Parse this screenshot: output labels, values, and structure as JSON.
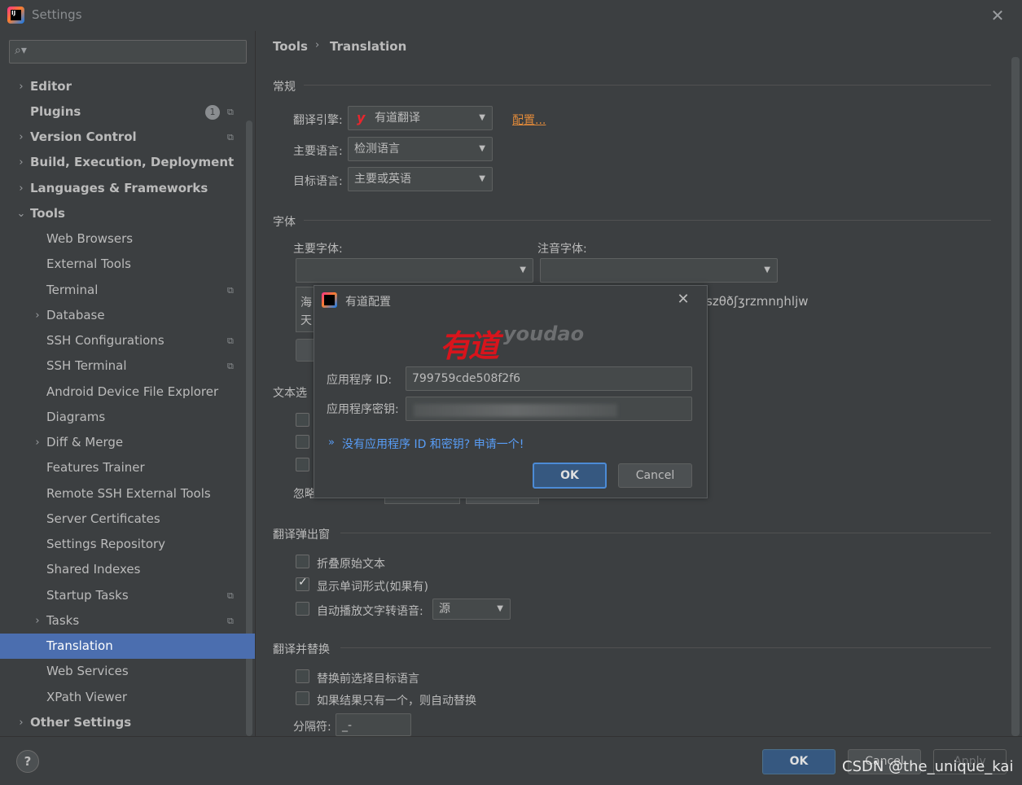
{
  "window": {
    "title": "Settings"
  },
  "sidebar": {
    "items": [
      {
        "label": "Editor",
        "arrow": "›"
      },
      {
        "label": "Plugins",
        "badge": "1"
      },
      {
        "label": "Version Control",
        "arrow": "›"
      },
      {
        "label": "Build, Execution, Deployment",
        "arrow": "›"
      },
      {
        "label": "Languages & Frameworks",
        "arrow": "›"
      },
      {
        "label": "Tools",
        "arrow": "⌄"
      },
      {
        "label": "Web Browsers"
      },
      {
        "label": "External Tools"
      },
      {
        "label": "Terminal"
      },
      {
        "label": "Database",
        "arrow": "›"
      },
      {
        "label": "SSH Configurations"
      },
      {
        "label": "SSH Terminal"
      },
      {
        "label": "Android Device File Explorer"
      },
      {
        "label": "Diagrams"
      },
      {
        "label": "Diff & Merge",
        "arrow": "›"
      },
      {
        "label": "Features Trainer"
      },
      {
        "label": "Remote SSH External Tools"
      },
      {
        "label": "Server Certificates"
      },
      {
        "label": "Settings Repository"
      },
      {
        "label": "Shared Indexes"
      },
      {
        "label": "Startup Tasks"
      },
      {
        "label": "Tasks",
        "arrow": "›"
      },
      {
        "label": "Translation"
      },
      {
        "label": "Web Services"
      },
      {
        "label": "XPath Viewer"
      },
      {
        "label": "Other Settings",
        "arrow": "›"
      }
    ]
  },
  "breadcrumb": {
    "parent": "Tools",
    "separator": "›",
    "current": "Translation"
  },
  "general": {
    "section": "常规",
    "engine_label": "翻译引擎:",
    "engine_value": "有道翻译",
    "engine_icon": "y",
    "configure_link": "配置...",
    "primary_lang_label": "主要语言:",
    "primary_lang_value": "检测语言",
    "target_lang_label": "目标语言:",
    "target_lang_value": "主要或英语"
  },
  "font": {
    "section": "字体",
    "primary_font_label": "主要字体:",
    "phonetic_font_label": "注音字体:",
    "preview_left_1": "海",
    "preview_left_2": "天",
    "preview_right": "szθðʃʒrzmnŋhljw"
  },
  "text_selection": {
    "section_partial": "文本选",
    "ignore_partial": "忽略"
  },
  "popup": {
    "section": "翻译弹出窗",
    "fold_label": "折叠原始文本",
    "show_forms_label": "显示单词形式(如果有)",
    "autoplay_label": "自动播放文字转语音:",
    "autoplay_value": "源"
  },
  "replace": {
    "section": "翻译并替换",
    "select_target_label": "替换前选择目标语言",
    "auto_replace_label": "如果结果只有一个，则自动替换",
    "separator_label": "分隔符:",
    "separator_value": "_-"
  },
  "dialog": {
    "title": "有道配置",
    "logo_cn": "有道",
    "logo_en": "youdao",
    "app_id_label": "应用程序 ID:",
    "app_id_value": "799759cde508f2f6",
    "app_key_label": "应用程序密钥:",
    "link_arrow": "»",
    "link_text": "没有应用程序 ID 和密钥? 申请一个!",
    "ok": "OK",
    "cancel": "Cancel"
  },
  "footer": {
    "help": "?",
    "ok": "OK",
    "cancel": "Cancel",
    "apply": "Apply",
    "watermark": "CSDN @the_unique_kai"
  },
  "colors": {
    "accent": "#4b6eaf",
    "link": "#589df6",
    "brand_red": "#d8141c",
    "config_link": "#e08a3a"
  }
}
